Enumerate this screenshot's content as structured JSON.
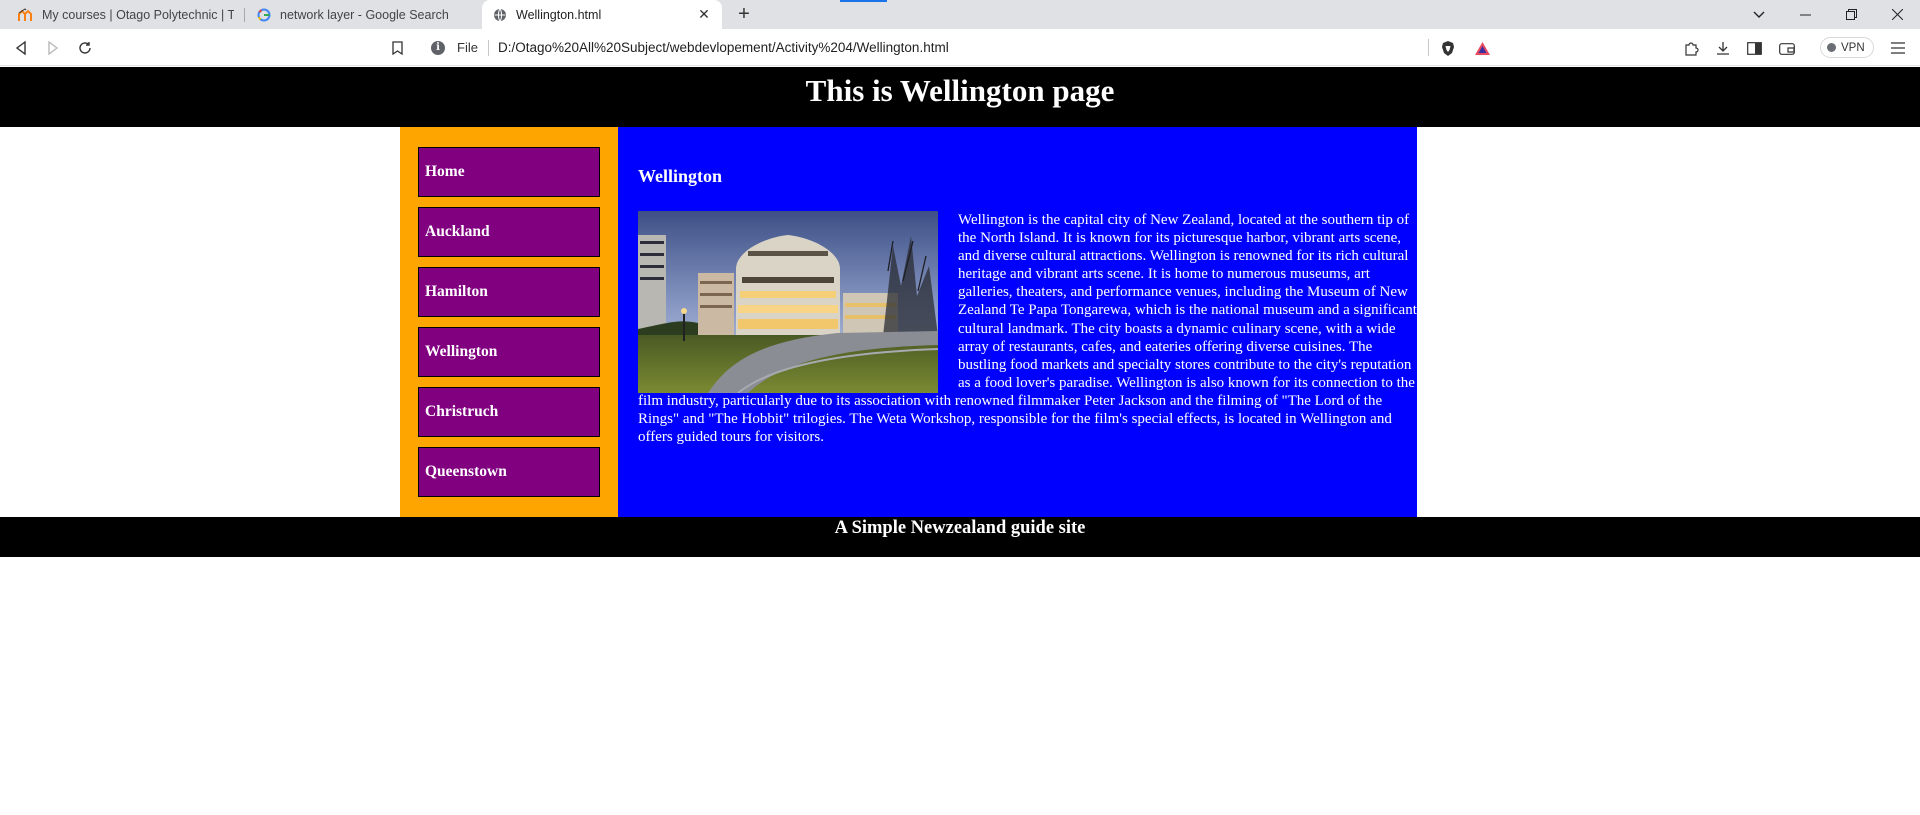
{
  "browser": {
    "tabs": [
      {
        "title": "My courses | Otago Polytechnic | Te P",
        "icon": "moodle-icon"
      },
      {
        "title": "network layer - Google Search",
        "icon": "google-icon"
      },
      {
        "title": "Wellington.html",
        "icon": "globe-icon"
      }
    ],
    "address": {
      "scheme_label": "File",
      "url": "D:/Otago%20All%20Subject/webdevlopement/Activity%204/Wellington.html"
    },
    "vpn_label": "VPN"
  },
  "page": {
    "header_title": "This is Wellington page",
    "nav": [
      "Home",
      "Auckland",
      "Hamilton",
      "Wellington",
      "Christruch",
      "Queenstown"
    ],
    "content_heading": "Wellington",
    "content_text": "Wellington is the capital city of New Zealand, located at the southern tip of the North Island. It is known for its picturesque harbor, vibrant arts scene, and diverse cultural attractions. Wellington is renowned for its rich cultural heritage and vibrant arts scene. It is home to numerous museums, art galleries, theaters, and performance venues, including the Museum of New Zealand Te Papa Tongarewa, which is the national museum and a significant cultural landmark. The city boasts a dynamic culinary scene, with a wide array of restaurants, cafes, and eateries offering diverse cuisines. The bustling food markets and specialty stores contribute to the city's reputation as a food lover's paradise. Wellington is also known for its connection to the film industry, particularly due to its association with renowned filmmaker Peter Jackson and the filming of \"The Lord of the Rings\" and \"The Hobbit\" trilogies. The Weta Workshop, responsible for the film's special effects, is located in Wellington and offers guided tours for visitors.",
    "footer_text": "A Simple Newzealand guide site"
  },
  "colors": {
    "header_bg": "#000000",
    "nav_bg": "#ffa500",
    "nav_item_bg": "#800080",
    "content_bg": "#0000ff"
  }
}
